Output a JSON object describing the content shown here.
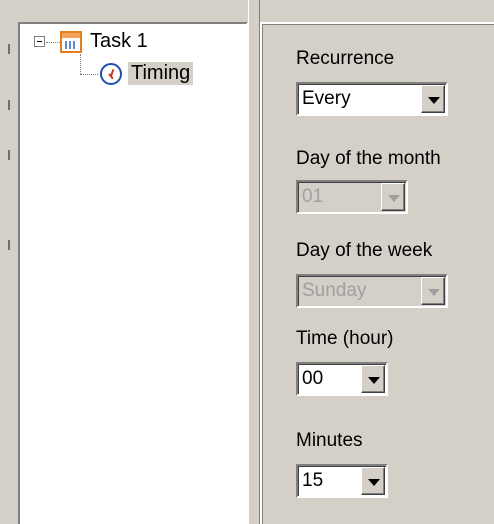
{
  "tree": {
    "task": {
      "label": "Task 1",
      "icon": "calendar-icon"
    },
    "timing": {
      "label": "Timing",
      "icon": "clock-icon",
      "selected": true
    }
  },
  "form": {
    "recurrence": {
      "label": "Recurrence",
      "value": "Every",
      "enabled": true
    },
    "day_of_month": {
      "label": "Day of the month",
      "value": "01",
      "enabled": false
    },
    "day_of_week": {
      "label": "Day of the week",
      "value": "Sunday",
      "enabled": false
    },
    "time_hour": {
      "label": "Time (hour)",
      "value": "00",
      "enabled": true
    },
    "minutes": {
      "label": "Minutes",
      "value": "15",
      "enabled": true
    }
  },
  "colors": {
    "panel_bg": "#d4d0c8",
    "tree_bg": "#ffffff",
    "disabled_text": "#a0a0a0"
  }
}
